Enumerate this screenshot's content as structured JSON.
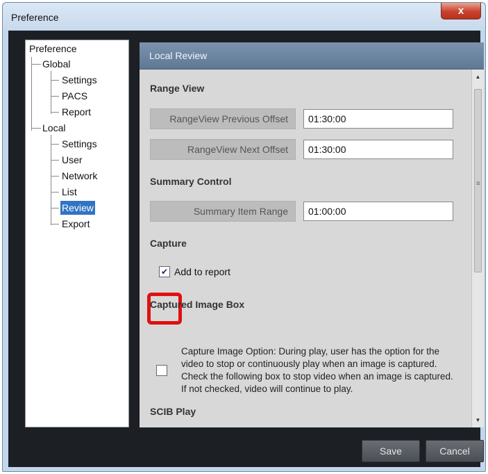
{
  "window": {
    "title": "Preference",
    "close_glyph": "x"
  },
  "tree": {
    "root": "Preference",
    "global": "Global",
    "global_items": [
      "Settings",
      "PACS",
      "Report"
    ],
    "local": "Local",
    "local_items": [
      "Settings",
      "User",
      "Network",
      "List",
      "Review",
      "Export"
    ],
    "selected": "Review"
  },
  "panel": {
    "title": "Local Review",
    "range_view": {
      "heading": "Range View",
      "previous_label": "RangeView Previous Offset",
      "previous_value": "01:30:00",
      "next_label": "RangeView Next Offset",
      "next_value": "01:30:00"
    },
    "summary_control": {
      "heading": "Summary Control",
      "range_label": "Summary Item Range",
      "range_value": "01:00:00"
    },
    "capture": {
      "heading": "Capture",
      "add_to_report_label": "Add to report",
      "add_to_report_checked": true
    },
    "captured_image_box": {
      "heading": "Captured Image Box",
      "description": "Capture Image Option: During play, user has the option for the video to stop or continuously play when an image is captured. Check the following box to stop video when an image is captured. If not checked, video will continue to play.",
      "checked": false
    },
    "scib_play": {
      "heading": "SCIB Play"
    }
  },
  "footer": {
    "save_label": "Save",
    "cancel_label": "Cancel"
  },
  "colors": {
    "highlight": "#e01010",
    "selection": "#3074c4"
  },
  "icons": {
    "checkmark": "check-icon",
    "scroll_up": "scroll-up-icon",
    "scroll_down": "scroll-down-icon"
  }
}
